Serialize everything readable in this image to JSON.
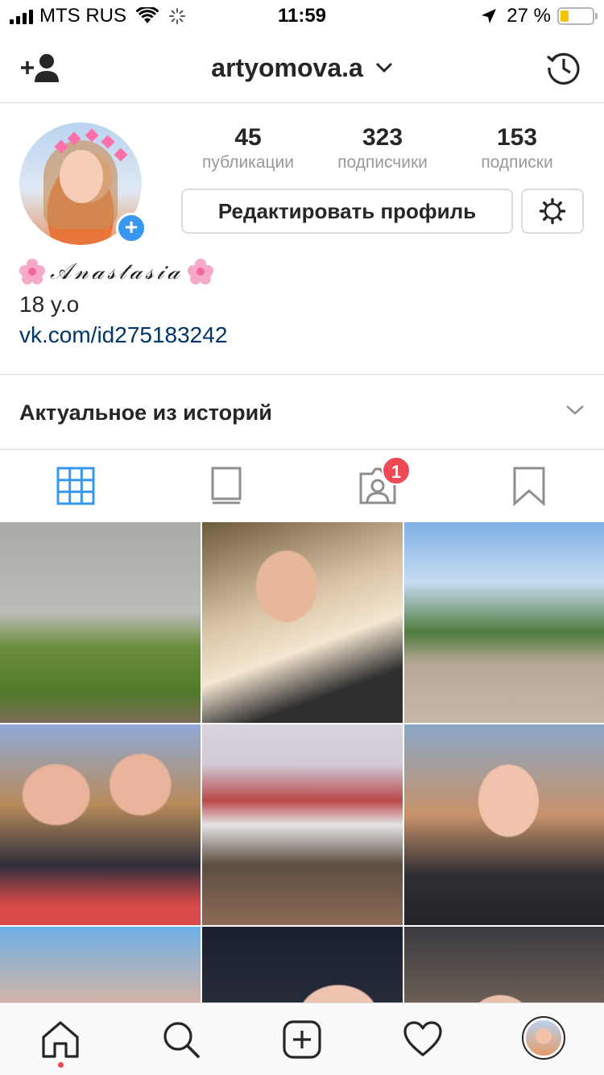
{
  "status_bar": {
    "carrier": "MTS RUS",
    "time": "11:59",
    "battery_percent": "27 %",
    "battery_level": 0.27
  },
  "header": {
    "username": "artyomova.a",
    "icons": {
      "left": "add-user-icon",
      "right": "archive-history-icon",
      "dropdown": "chevron-down-icon"
    }
  },
  "profile": {
    "stats": {
      "posts": {
        "value": "45",
        "label": "публикации"
      },
      "followers": {
        "value": "323",
        "label": "подписчики"
      },
      "following": {
        "value": "153",
        "label": "подписки"
      }
    },
    "edit_button": "Редактировать профиль",
    "bio": {
      "name": "𝒜𝓃𝒶𝓈𝓉𝒶𝓈𝒾𝒶",
      "age": "18 y.o",
      "link": "vk.com/id275183242"
    }
  },
  "highlights": {
    "title": "Актуальное из историй"
  },
  "tabs": {
    "items": [
      "grid-icon",
      "feed-icon",
      "tagged-icon",
      "saved-icon"
    ],
    "active": "grid-icon",
    "tagged_badge": "1"
  },
  "colors": {
    "accent": "#3897f0",
    "badge": "#ed4956",
    "link": "#003569",
    "muted": "#999999",
    "border": "#dbdbdb"
  },
  "bottom_nav": {
    "items": [
      "home-icon",
      "search-icon",
      "add-post-icon",
      "activity-heart-icon",
      "profile-avatar"
    ]
  }
}
